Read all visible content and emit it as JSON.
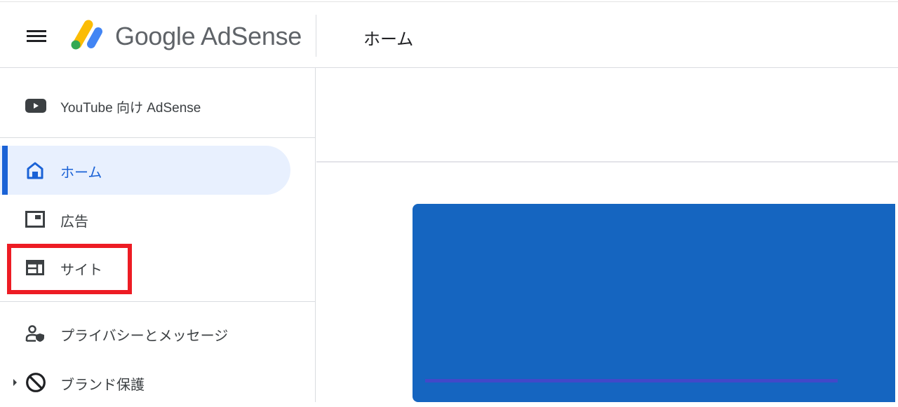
{
  "header": {
    "menu_icon": "hamburger-menu-icon",
    "logo_icon": "google-adsense-logo-icon",
    "app_name": "Google AdSense",
    "page_title": "ホーム"
  },
  "sidebar": {
    "youtube_item": {
      "icon": "youtube-icon",
      "label": "YouTube 向け AdSense"
    },
    "items": [
      {
        "id": "home",
        "icon": "home-icon",
        "label": "ホーム",
        "active": true
      },
      {
        "id": "ads",
        "icon": "ads-icon",
        "label": "広告"
      },
      {
        "id": "sites",
        "icon": "sites-icon",
        "label": "サイト",
        "highlighted": true
      },
      {
        "id": "privacy",
        "icon": "privacy-messaging-icon",
        "label": "プライバシーとメッセージ"
      },
      {
        "id": "brand",
        "icon": "block-icon",
        "label": "ブランド保護",
        "expandable": true
      }
    ]
  },
  "colors": {
    "accent": "#1a62d6",
    "active_bg": "#e8f0fe",
    "highlight_box": "#ed1c24",
    "card": "#1565c0"
  }
}
